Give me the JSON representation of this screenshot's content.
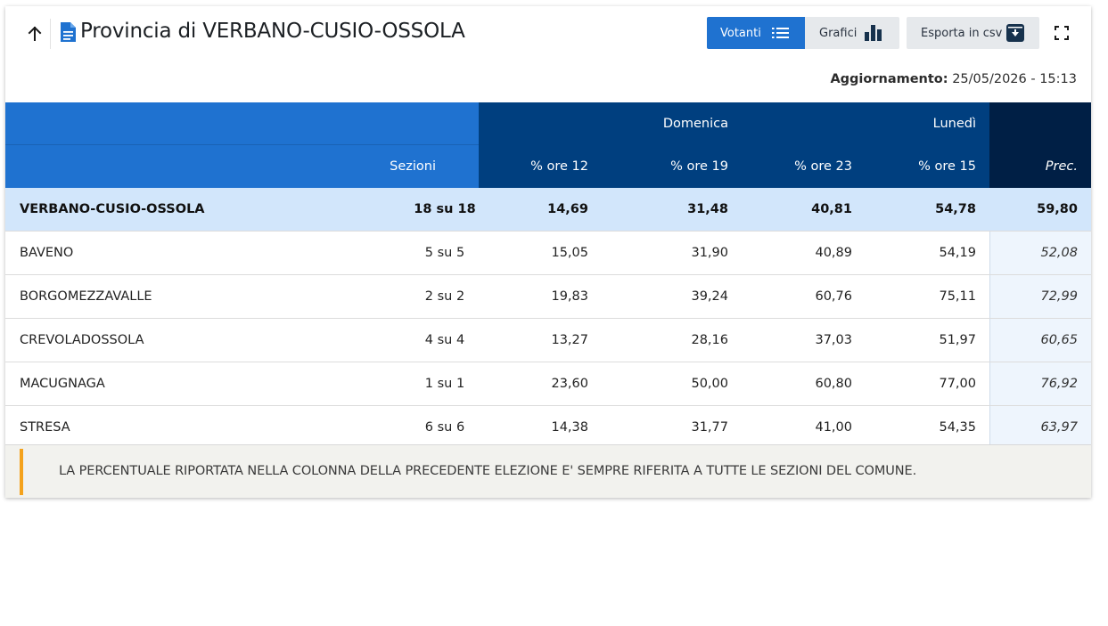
{
  "header": {
    "title": "Provincia di VERBANO-CUSIO-OSSOLA",
    "updated_label": "Aggiornamento:",
    "updated_value": "25/05/2026 - 15:13"
  },
  "toolbar": {
    "votanti_label": "Votanti",
    "grafici_label": "Grafici",
    "csv_label": "Esporta in csv"
  },
  "table": {
    "group_headers": {
      "domenica": "Domenica",
      "lunedi": "Lunedì"
    },
    "columns": {
      "sezioni": "Sezioni",
      "ore12": "% ore 12",
      "ore19": "% ore 19",
      "ore23": "% ore 23",
      "ore15": "% ore 15",
      "prec": "Prec."
    },
    "total": {
      "name": "VERBANO-CUSIO-OSSOLA",
      "sezioni": "18 su 18",
      "ore12": "14,69",
      "ore19": "31,48",
      "ore23": "40,81",
      "ore15": "54,78",
      "prec": "59,80"
    },
    "rows": [
      {
        "name": "BAVENO",
        "sezioni": "5 su 5",
        "ore12": "15,05",
        "ore19": "31,90",
        "ore23": "40,89",
        "ore15": "54,19",
        "prec": "52,08"
      },
      {
        "name": "BORGOMEZZAVALLE",
        "sezioni": "2 su 2",
        "ore12": "19,83",
        "ore19": "39,24",
        "ore23": "60,76",
        "ore15": "75,11",
        "prec": "72,99"
      },
      {
        "name": "CREVOLADOSSOLA",
        "sezioni": "4 su 4",
        "ore12": "13,27",
        "ore19": "28,16",
        "ore23": "37,03",
        "ore15": "51,97",
        "prec": "60,65"
      },
      {
        "name": "MACUGNAGA",
        "sezioni": "1 su 1",
        "ore12": "23,60",
        "ore19": "50,00",
        "ore23": "60,80",
        "ore15": "77,00",
        "prec": "76,92"
      },
      {
        "name": "STRESA",
        "sezioni": "6 su 6",
        "ore12": "14,38",
        "ore19": "31,77",
        "ore23": "41,00",
        "ore15": "54,35",
        "prec": "63,97"
      }
    ]
  },
  "note": "LA PERCENTUALE RIPORTATA NELLA COLONNA DELLA PRECEDENTE ELEZIONE E' SEMPRE RIFERITA A TUTTE LE SEZIONI DEL COMUNE.",
  "icons": {
    "back": "arrow-up-icon",
    "doc": "document-icon",
    "list": "list-icon",
    "chart": "bar-chart-icon",
    "download": "download-box-icon",
    "fullscreen": "fullscreen-icon"
  },
  "colors": {
    "primary": "#1f72d0",
    "navy": "#003f7f",
    "dark_navy": "#001f45",
    "total_row": "#d2e6fb",
    "note_accent": "#f4a21c"
  }
}
